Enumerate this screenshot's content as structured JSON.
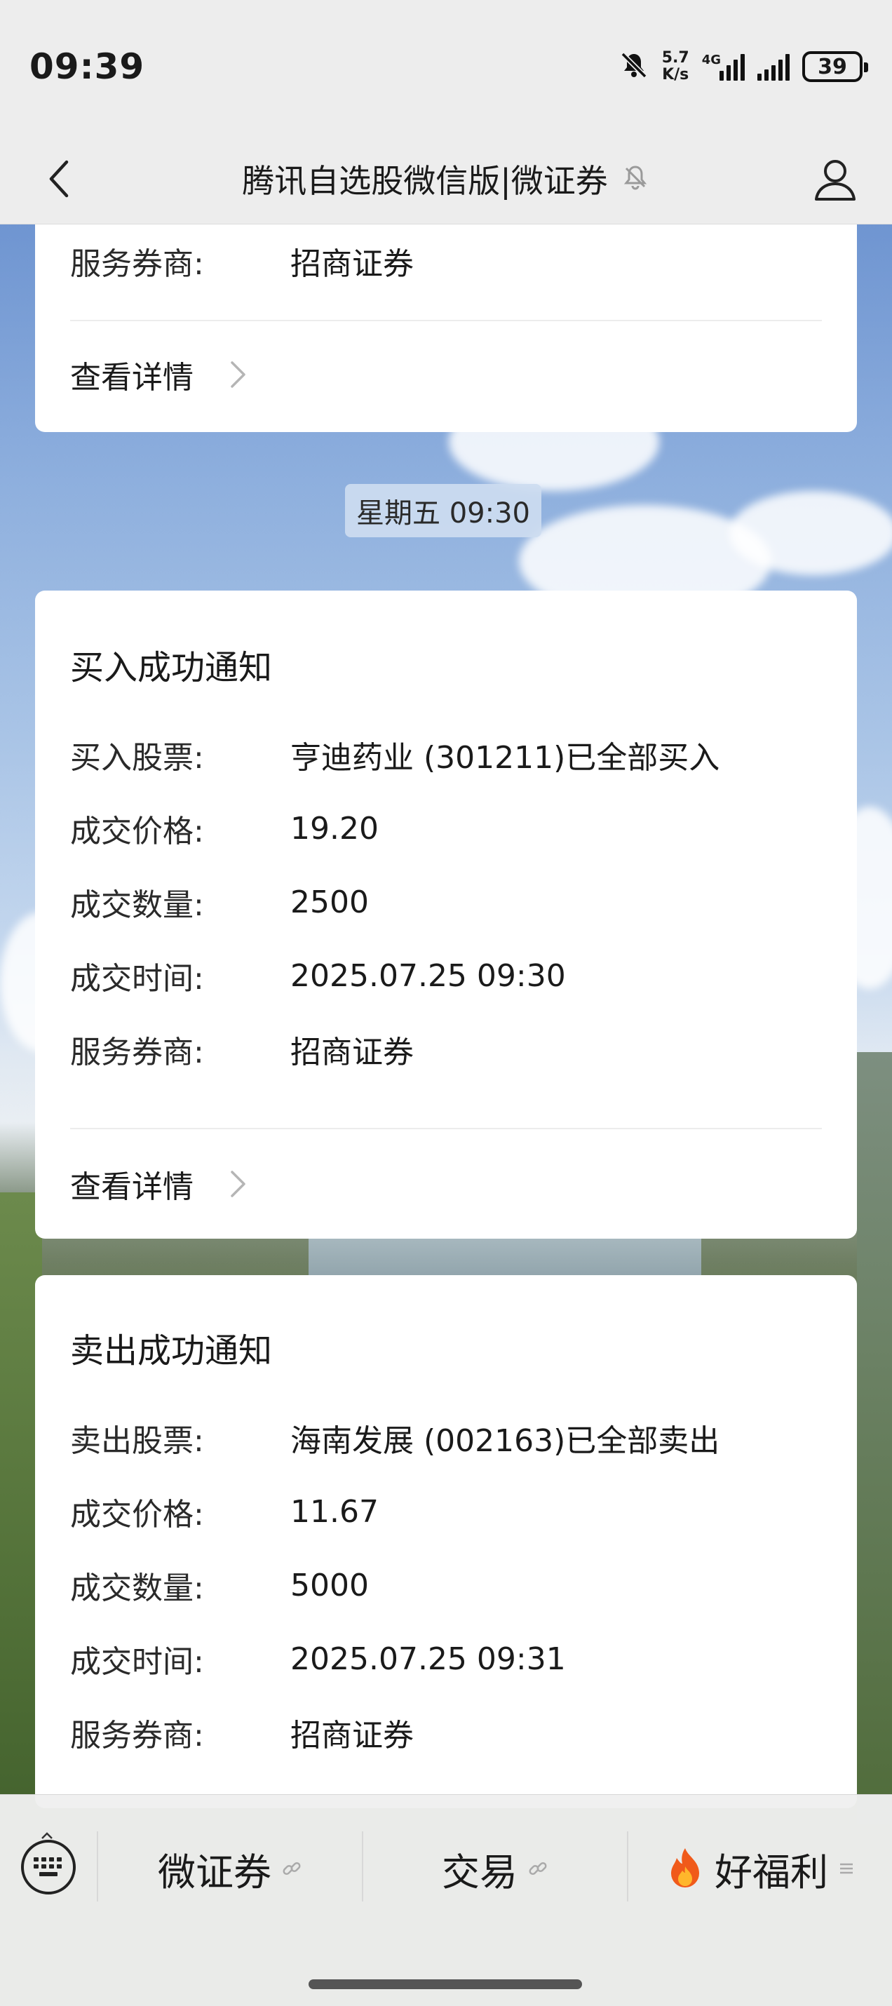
{
  "status_bar": {
    "time": "09:39",
    "net_speed_top": "5.7",
    "net_speed_bottom": "K/s",
    "net_type": "4G",
    "battery": "39"
  },
  "nav": {
    "title": "腾讯自选股微信版|微证券"
  },
  "top_card": {
    "broker_label": "服务券商:",
    "broker_value": "招商证券",
    "details_label": "查看详情"
  },
  "timestamp": "星期五 09:30",
  "buy_card": {
    "title": "买入成功通知",
    "rows": [
      {
        "label": "买入股票:",
        "value": "亨迪药业 (301211)已全部买入"
      },
      {
        "label": "成交价格:",
        "value": "19.20"
      },
      {
        "label": "成交数量:",
        "value": "2500"
      },
      {
        "label": "成交时间:",
        "value": "2025.07.25 09:30"
      },
      {
        "label": "服务券商:",
        "value": "招商证券"
      }
    ],
    "details_label": "查看详情"
  },
  "sell_card": {
    "title": "卖出成功通知",
    "rows": [
      {
        "label": "卖出股票:",
        "value": "海南发展 (002163)已全部卖出"
      },
      {
        "label": "成交价格:",
        "value": "11.67"
      },
      {
        "label": "成交数量:",
        "value": "5000"
      },
      {
        "label": "成交时间:",
        "value": "2025.07.25 09:31"
      },
      {
        "label": "服务券商:",
        "value": "招商证券"
      }
    ]
  },
  "bottom_menu": {
    "items": [
      {
        "label": "微证券",
        "icon": "link-icon"
      },
      {
        "label": "交易",
        "icon": "link-icon"
      },
      {
        "label": "好福利",
        "prefix_icon": "fire-icon",
        "icon": "list-icon"
      }
    ]
  },
  "colors": {
    "nav_bg": "#ededed",
    "card_bg": "#ffffff",
    "pill_bg": "#cddcf0",
    "text": "#1a1a1a"
  }
}
